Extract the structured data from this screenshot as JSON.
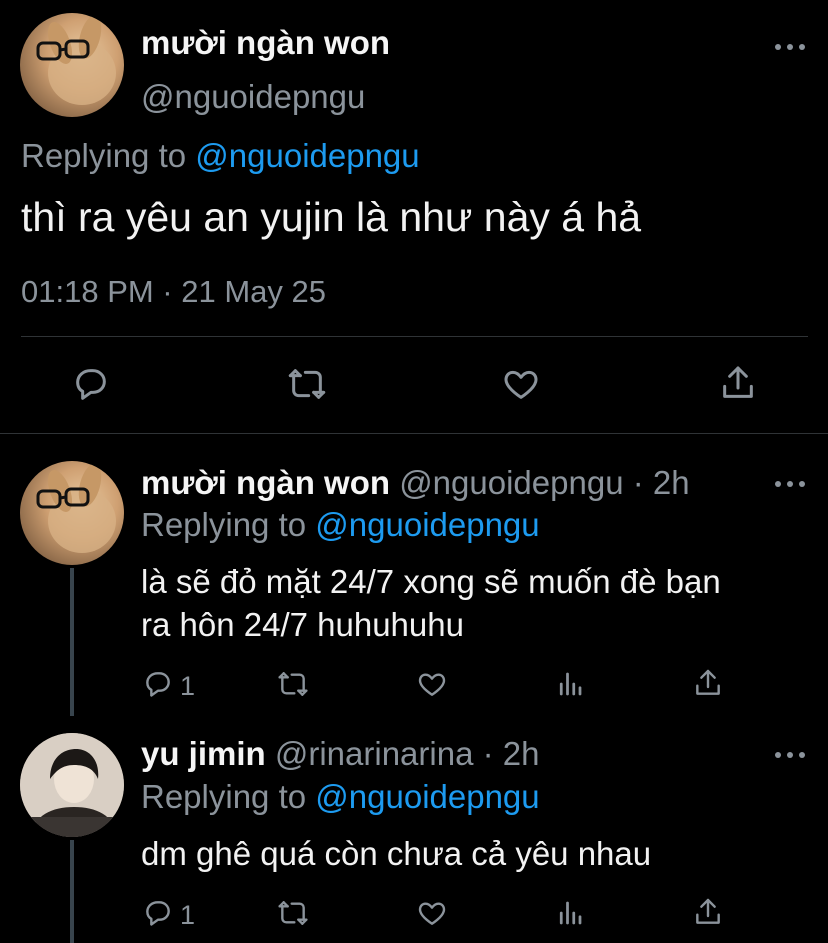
{
  "main_tweet": {
    "display_name": "mười ngàn won",
    "handle": "@nguoidepngu",
    "replying_prefix": "Replying to",
    "replying_to": "@nguoidepngu",
    "text": "thì ra yêu an yujin là như này á hả",
    "timestamp": "01:18 PM · 21 May 25",
    "actions": [
      "reply-icon",
      "retweet-icon",
      "like-icon",
      "share-icon"
    ]
  },
  "replies": [
    {
      "display_name": "mười ngàn won",
      "handle": "@nguoidepngu",
      "separator": "·",
      "time": "2h",
      "replying_prefix": "Replying to",
      "replying_to": "@nguoidepngu",
      "text_line1": "là sẽ đỏ mặt 24/7 xong sẽ muốn đè bạn",
      "text_line2": "ra hôn 24/7 huhuhuhu",
      "reply_count": "1"
    },
    {
      "display_name": "yu jimin",
      "handle": "@rinarinarina",
      "separator": "·",
      "time": "2h",
      "replying_prefix": "Replying to",
      "replying_to": "@nguoidepngu",
      "text_line1": "dm ghê quá còn chưa cả yêu nhau",
      "reply_count": "1"
    }
  ],
  "colors": {
    "background": "#000000",
    "link": "#1d9bf0",
    "muted": "#8b939b",
    "text": "#f2f2f2"
  }
}
